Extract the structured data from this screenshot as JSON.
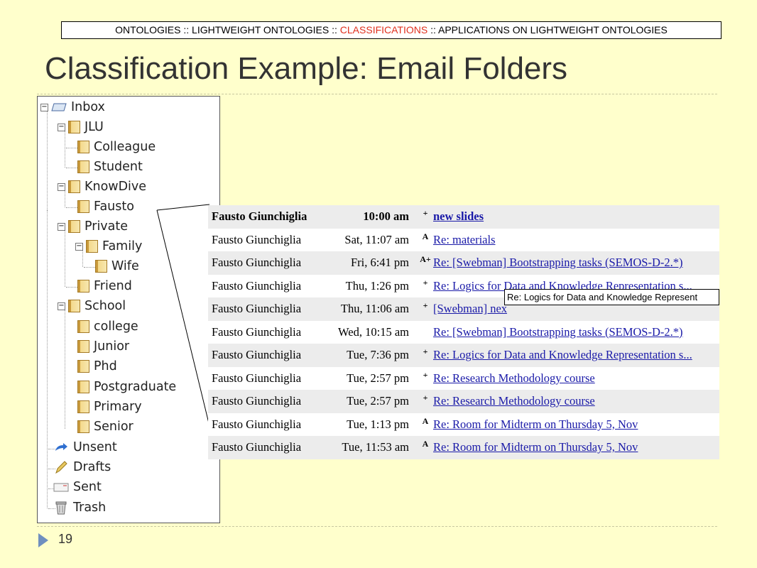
{
  "header": {
    "breadcrumb_part1": "ONTOLOGIES :: ",
    "breadcrumb_part2": "LIGHTWEIGHT ONTOLOGIES :: ",
    "breadcrumb_active": "CLASSIFICATIONS",
    "breadcrumb_part3": " :: APPLICATIONS ON LIGHTWEIGHT ONTOLOGIES",
    "active_color": "#e0301e"
  },
  "slide": {
    "title": "Classification Example: Email Folders",
    "page_number": "19"
  },
  "tree": {
    "inbox": "Inbox",
    "jlu": "JLU",
    "colleague": "Colleague",
    "student": "Student",
    "knowdive": "KnowDive",
    "fausto": "Fausto",
    "private": "Private",
    "family": "Family",
    "wife": "Wife",
    "friend": "Friend",
    "school": "School",
    "college": "college",
    "junior": "Junior",
    "phd": "Phd",
    "postgraduate": "Postgraduate",
    "primary": "Primary",
    "senior": "Senior",
    "unsent": "Unsent",
    "drafts": "Drafts",
    "sent": "Sent",
    "trash": "Trash",
    "collapse_symbol": "−"
  },
  "emails": [
    {
      "from": "Fausto Giunchiglia",
      "time": "10:00 am",
      "flag": "+",
      "subject": "new slides"
    },
    {
      "from": "Fausto Giunchiglia",
      "time": "Sat, 11:07 am",
      "flag": "A",
      "subject": "Re: materials"
    },
    {
      "from": "Fausto Giunchiglia",
      "time": "Fri, 6:41 pm",
      "flag": "A+",
      "subject": "Re: [Swebman] Bootstrapping tasks (SEMOS-D-2.*)"
    },
    {
      "from": "Fausto Giunchiglia",
      "time": "Thu, 1:26 pm",
      "flag": "+",
      "subject": "Re: Logics for Data and Knowledge Representation s..."
    },
    {
      "from": "Fausto Giunchiglia",
      "time": "Thu, 11:06 am",
      "flag": "+",
      "subject": "[Swebman] nex"
    },
    {
      "from": "Fausto Giunchiglia",
      "time": "Wed, 10:15 am",
      "flag": "",
      "subject": "Re: [Swebman] Bootstrapping tasks (SEMOS-D-2.*)"
    },
    {
      "from": "Fausto Giunchiglia",
      "time": "Tue, 7:36 pm",
      "flag": "+",
      "subject": "Re: Logics for Data and Knowledge Representation s..."
    },
    {
      "from": "Fausto Giunchiglia",
      "time": "Tue, 2:57 pm",
      "flag": "+",
      "subject": "Re: Research Methodology course"
    },
    {
      "from": "Fausto Giunchiglia",
      "time": "Tue, 2:57 pm",
      "flag": "+",
      "subject": "Re: Research Methodology course"
    },
    {
      "from": "Fausto Giunchiglia",
      "time": "Tue, 1:13 pm",
      "flag": "A",
      "subject": "Re: Room for Midterm on Thursday 5, Nov"
    },
    {
      "from": "Fausto Giunchiglia",
      "time": "Tue, 11:53 am",
      "flag": "A",
      "subject": "Re: Room for Midterm on Thursday 5, Nov"
    }
  ],
  "tooltip": "Re: Logics for Data and Knowledge Represent"
}
